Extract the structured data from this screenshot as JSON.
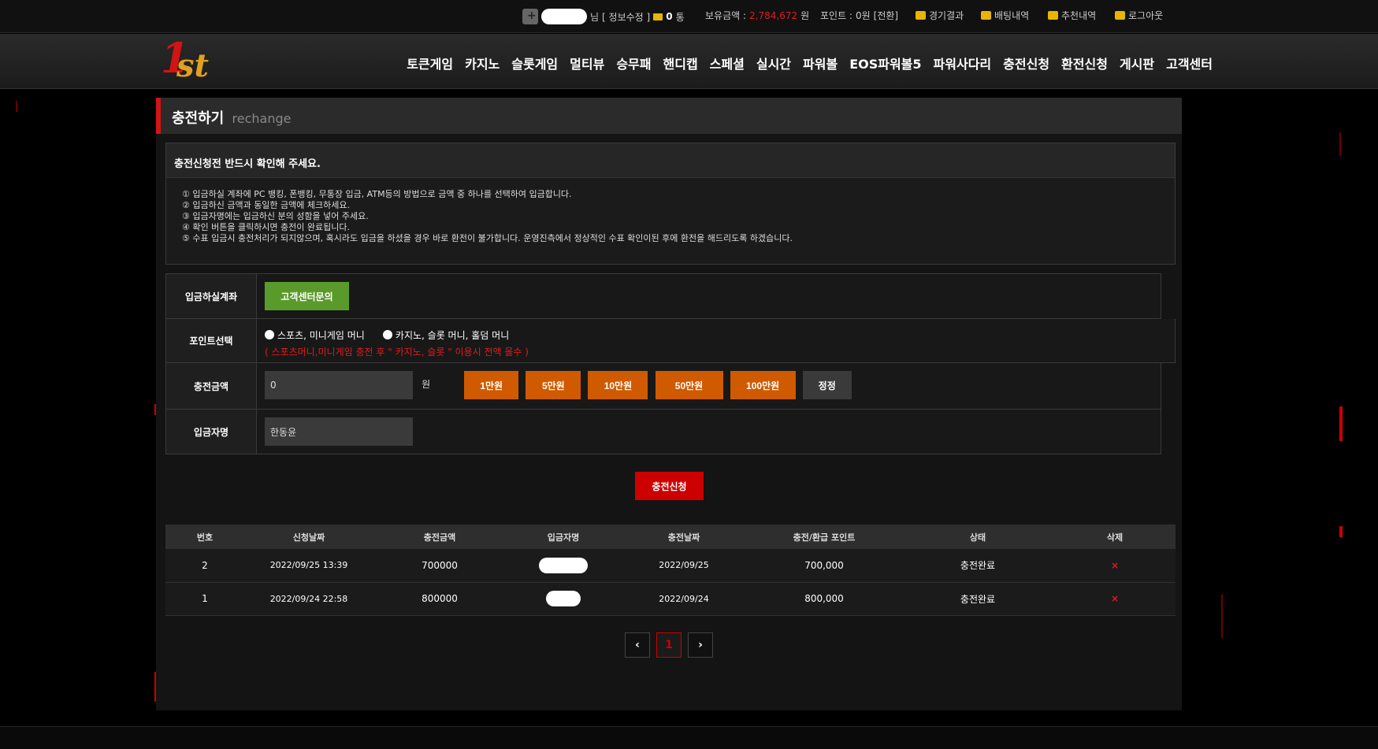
{
  "topbar": {
    "user_suffix": "님",
    "profile_edit": "[ 정보수정 ]",
    "message_count": "0",
    "message_unit": "통",
    "balance_label": "보유금액 :",
    "balance_value": "2,784,672",
    "balance_unit": "원",
    "point_label": "포인트 :",
    "point_value": "0원",
    "point_convert": "[전환]",
    "results": "경기결과",
    "bets": "배팅내역",
    "referrals": "추천내역",
    "logout": "로그아웃"
  },
  "logo": {
    "num": "1",
    "suffix": "st"
  },
  "nav": [
    "토큰게임",
    "카지노",
    "슬롯게임",
    "멀티뷰",
    "승무패",
    "핸디캡",
    "스페셜",
    "실시간",
    "파워볼",
    "EOS파워볼5",
    "파워사다리",
    "충전신청",
    "환전신청",
    "게시판",
    "고객센터"
  ],
  "page": {
    "title": "충전하기",
    "subtitle": "rechange"
  },
  "notice": {
    "heading": "충전신청전 반드시 확인해 주세요.",
    "lines": [
      "① 입금하실 계좌에 PC 뱅킹, 폰뱅킹, 무통장 입금, ATM등의 방법으로 금액 중 하나를 선택하여 입금합니다.",
      "② 입금하신 금액과 동일한 금액에 체크하세요.",
      "③ 입금자명에는 입금하신 분의 성함을 넣어 주세요.",
      "④ 확인 버튼을 클릭하시면 충전이 완료됩니다.",
      "⑤ 수표 입금시 충전처리가 되지않으며, 혹시라도 입금을 하셨을 경우 바로 환전이 불가합니다. 운영진측에서 정상적인 수표 확인이된 후에 환전을 해드리도록 하겠습니다."
    ]
  },
  "form": {
    "account_label": "입금하실계좌",
    "account_button": "고객센터문의",
    "point_label": "포인트선택",
    "point_options": [
      "스포츠, 미니게임 머니",
      "카지노, 슬롯 머니, 홀덤 머니"
    ],
    "point_warning": "( 스포츠머니,미니게임 충전 후 \" 카지노, 슬롯 \" 이용시 전액 몰수 )",
    "amount_label": "충전금액",
    "amount_value": "0",
    "amount_unit": "원",
    "amount_buttons": [
      "1만원",
      "5만원",
      "10만원",
      "50만원",
      "100만원"
    ],
    "reset_button": "정정",
    "name_label": "입금자명",
    "name_value": "한동윤"
  },
  "submit_label": "충전신청",
  "history": {
    "columns": [
      "번호",
      "신청날짜",
      "충전금액",
      "입금자명",
      "충전날짜",
      "충전/환급 포인트",
      "상태",
      "삭제"
    ],
    "rows": [
      {
        "no": "2",
        "requested": "2022/09/25 13:39",
        "amount": "700000",
        "charged": "2022/09/25",
        "points": "700,000",
        "status": "충전완료",
        "delete": "×"
      },
      {
        "no": "1",
        "requested": "2022/09/24 22:58",
        "amount": "800000",
        "charged": "2022/09/24",
        "points": "800,000",
        "status": "충전완료",
        "delete": "×"
      }
    ]
  },
  "pager": {
    "prev": "‹",
    "current": "1",
    "next": "›"
  },
  "colors": {
    "accent_red": "#d21414",
    "orange": "#d05a00",
    "green": "#5a9a2a"
  }
}
